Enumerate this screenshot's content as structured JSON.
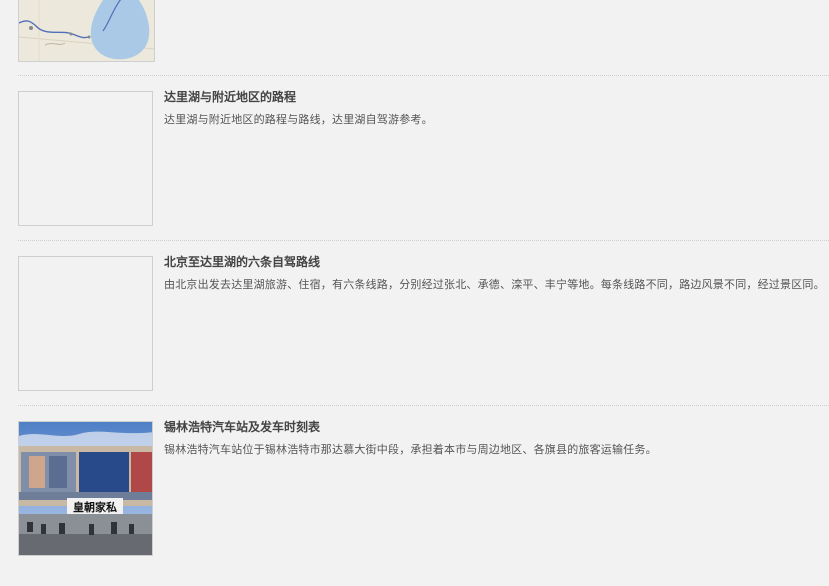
{
  "items": [
    {
      "title": "",
      "desc": "",
      "thumb": "map"
    },
    {
      "title": "达里湖与附近地区的路程",
      "desc": "达里湖与附近地区的路程与路线，达里湖自驾游参考。",
      "thumb": "empty"
    },
    {
      "title": "北京至达里湖的六条自驾路线",
      "desc": "由北京出发去达里湖旅游、住宿，有六条线路，分别经过张北、承德、滦平、丰宁等地。每条线路不同，路边风景不同，经过景区同。",
      "thumb": "empty"
    },
    {
      "title": "锡林浩特汽车站及发车时刻表",
      "desc": "锡林浩特汽车站位于锡林浩特市那达慕大街中段，承担着本市与周边地区、各旗县的旅客运输任务。",
      "thumb": "photo",
      "sign": "皇朝家私"
    }
  ],
  "colors": {
    "background": "#f2f2f2",
    "title": "#444444",
    "text": "#555555",
    "lake": "#a9c9e7"
  }
}
